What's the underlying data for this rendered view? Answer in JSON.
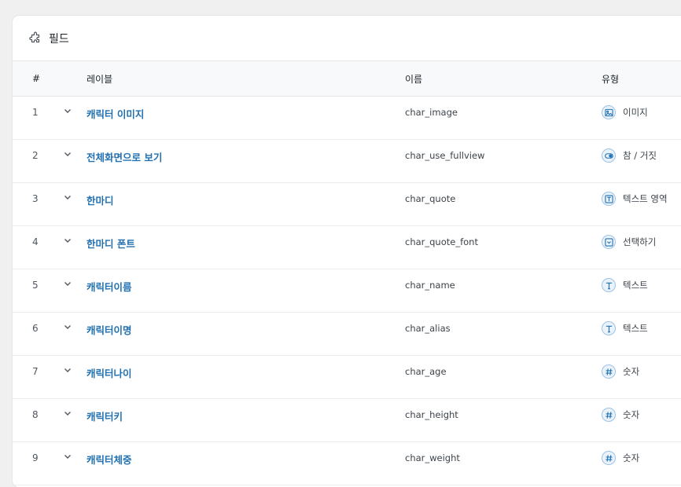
{
  "panel": {
    "title": "필드",
    "header_icon": "puzzle-icon"
  },
  "table": {
    "columns": {
      "num": "#",
      "label": "레이블",
      "name": "이름",
      "type": "유형"
    },
    "rows": [
      {
        "num": "1",
        "label": "캐릭터 이미지",
        "name": "char_image",
        "type": "이미지",
        "type_icon": "image-icon"
      },
      {
        "num": "2",
        "label": "전체화면으로 보기",
        "name": "char_use_fullview",
        "type": "참 / 거짓",
        "type_icon": "toggle-icon"
      },
      {
        "num": "3",
        "label": "한마디",
        "name": "char_quote",
        "type": "텍스트 영역",
        "type_icon": "textarea-icon"
      },
      {
        "num": "4",
        "label": "한마디 폰트",
        "name": "char_quote_font",
        "type": "선택하기",
        "type_icon": "select-icon"
      },
      {
        "num": "5",
        "label": "캐릭터이름",
        "name": "char_name",
        "type": "텍스트",
        "type_icon": "text-icon"
      },
      {
        "num": "6",
        "label": "캐릭터이명",
        "name": "char_alias",
        "type": "텍스트",
        "type_icon": "text-icon"
      },
      {
        "num": "7",
        "label": "캐릭터나이",
        "name": "char_age",
        "type": "숫자",
        "type_icon": "number-icon"
      },
      {
        "num": "8",
        "label": "캐릭터키",
        "name": "char_height",
        "type": "숫자",
        "type_icon": "number-icon"
      },
      {
        "num": "9",
        "label": "캐릭터체중",
        "name": "char_weight",
        "type": "숫자",
        "type_icon": "number-icon"
      }
    ]
  },
  "colors": {
    "accent": "#2271b1",
    "background": "#f0f0f0",
    "panel": "#ffffff"
  }
}
